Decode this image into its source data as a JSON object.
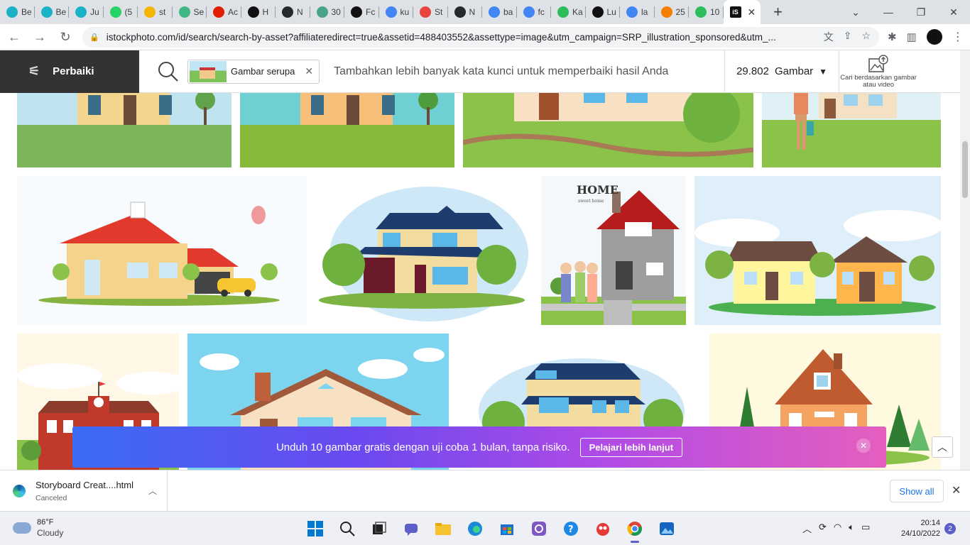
{
  "browser": {
    "tabs": [
      {
        "label": "Be",
        "icon": "canva-icon",
        "color": "#1bb1c7"
      },
      {
        "label": "Be",
        "icon": "canva-icon",
        "color": "#1bb1c7"
      },
      {
        "label": "Ju",
        "icon": "canva-icon",
        "color": "#1bb1c7"
      },
      {
        "label": "(5",
        "icon": "whatsapp-icon",
        "color": "#25d366"
      },
      {
        "label": "st",
        "icon": "google-drive-icon",
        "color": "#f4b400"
      },
      {
        "label": "Se",
        "icon": "vuejs-icon",
        "color": "#41b883"
      },
      {
        "label": "Ac",
        "icon": "adobe-icon",
        "color": "#e01e00"
      },
      {
        "label": "H",
        "icon": "storyboard-icon",
        "color": "#111111"
      },
      {
        "label": "N",
        "icon": "github-icon",
        "color": "#24292e"
      },
      {
        "label": "30",
        "icon": "docs-icon",
        "color": "#4aa48c"
      },
      {
        "label": "Fc",
        "icon": "istock-icon",
        "color": "#111111"
      },
      {
        "label": "ku",
        "icon": "google-icon",
        "color": "#4285f4"
      },
      {
        "label": "St",
        "icon": "chat-icon",
        "color": "#e8453c"
      },
      {
        "label": "N",
        "icon": "github-icon",
        "color": "#24292e"
      },
      {
        "label": "ba",
        "icon": "google-icon",
        "color": "#4285f4"
      },
      {
        "label": "fc",
        "icon": "google-icon",
        "color": "#4285f4"
      },
      {
        "label": "Ka",
        "icon": "pixlr-icon",
        "color": "#2dbd5a"
      },
      {
        "label": "Lu",
        "icon": "istock-icon",
        "color": "#111111"
      },
      {
        "label": "la",
        "icon": "google-icon",
        "color": "#4285f4"
      },
      {
        "label": "25",
        "icon": "blogger-icon",
        "color": "#f57d00"
      },
      {
        "label": "10",
        "icon": "pixlr-icon",
        "color": "#2dbd5a"
      }
    ],
    "url": "istockphoto.com/id/search/search-by-asset?affiliateredirect=true&assetid=488403552&assettype=image&utm_campaign=SRP_illustration_sponsored&utm_..."
  },
  "header": {
    "refine_label": "Perbaiki",
    "chip_label": "Gambar serupa",
    "search_placeholder": "Tambahkan lebih banyak kata kunci untuk memperbaiki hasil Anda",
    "count": "29.802",
    "type_label": "Gambar",
    "search_by_image": "Cari berdasarkan gambar atau video"
  },
  "promo": {
    "text": "Unduh 10 gambar gratis dengan uji coba 1 bulan, tanpa risiko.",
    "button": "Pelajari lebih lanjut"
  },
  "download": {
    "filename": "Storyboard Creat....html",
    "status": "Canceled",
    "show_all": "Show all"
  },
  "taskbar": {
    "temp": "86°F",
    "weather": "Cloudy",
    "time": "20:14",
    "date": "24/10/2022",
    "notifications": "2"
  },
  "tile_texts": {
    "home_title": "HOME",
    "home_sub": "sweet home"
  }
}
